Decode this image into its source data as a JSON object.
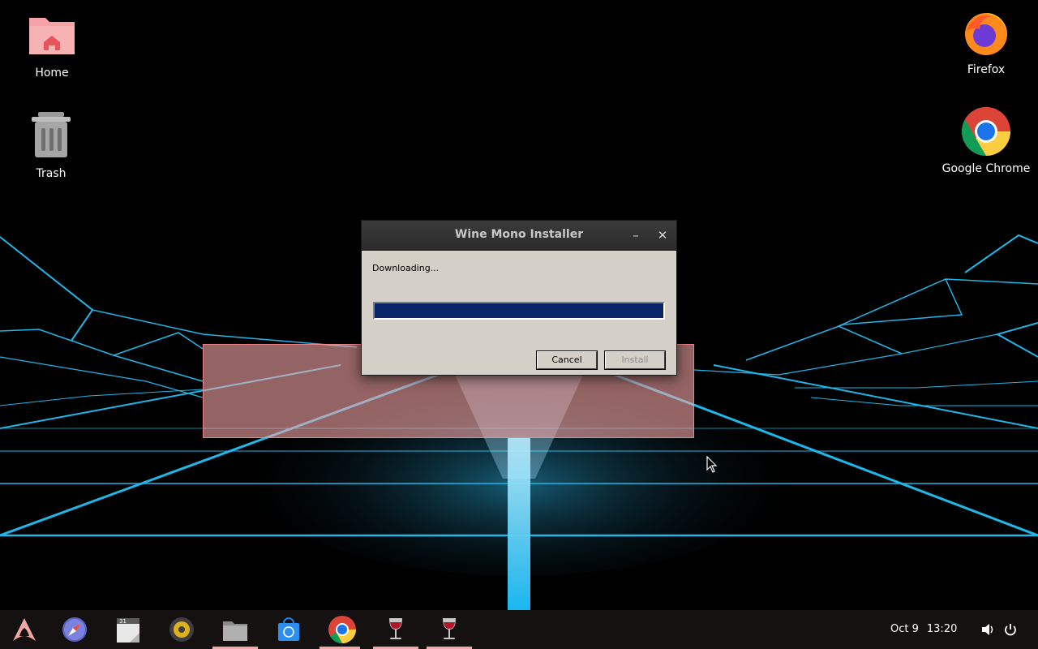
{
  "desktop": {
    "icons": [
      {
        "label": "Home",
        "icon": "home-folder-icon"
      },
      {
        "label": "Trash",
        "icon": "trash-icon"
      },
      {
        "label": "Firefox",
        "icon": "firefox-icon"
      },
      {
        "label": "Google Chrome",
        "icon": "chrome-icon"
      }
    ]
  },
  "dialog": {
    "title": "Wine Mono Installer",
    "status": "Downloading...",
    "progress": 1.0,
    "cancel_label": "Cancel",
    "install_label": "Install",
    "install_enabled": false,
    "minimize_glyph": "–",
    "close_glyph": "✕"
  },
  "taskbar": {
    "apps": [
      {
        "name": "app-menu",
        "icon": "arch-logo-icon",
        "running": false
      },
      {
        "name": "web-browser",
        "icon": "compass-icon",
        "running": false
      },
      {
        "name": "calendar",
        "icon": "calendar-icon",
        "running": false
      },
      {
        "name": "music-player",
        "icon": "speaker-icon",
        "running": false
      },
      {
        "name": "file-manager",
        "icon": "folder-icon",
        "running": true
      },
      {
        "name": "software-store",
        "icon": "store-bag-icon",
        "running": false
      },
      {
        "name": "google-chrome",
        "icon": "chrome-icon",
        "running": true
      },
      {
        "name": "wine-1",
        "icon": "wine-glass-icon",
        "running": true
      },
      {
        "name": "wine-2",
        "icon": "wine-glass-icon",
        "running": true
      }
    ],
    "clock": {
      "date": "Oct 9",
      "time": "13:20"
    },
    "tray": [
      "volume-icon",
      "power-icon"
    ]
  },
  "colors": {
    "grid_accent": "#1fb6e8",
    "taskbar_accent": "#f2a7a7",
    "dialog_face": "#d4d0c8",
    "progress_fill": "#0a246a"
  }
}
